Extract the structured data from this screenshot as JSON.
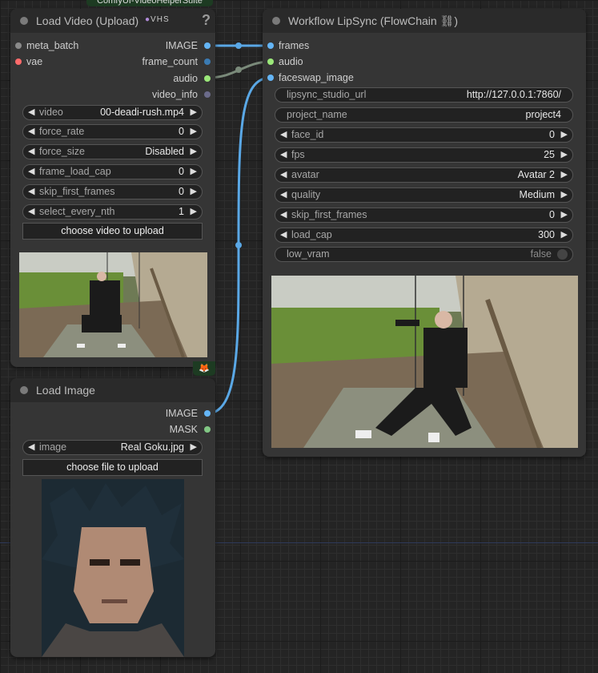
{
  "pack_tag": "ComfyUI-VideoHelperSuite",
  "colors": {
    "image_slot": "#64b5f6",
    "audio_slot": "#9be87a",
    "vae_slot": "#ff6b6b",
    "link": "#5aa8e6"
  },
  "load_video": {
    "title": "Load Video (Upload)",
    "badge": "VHS",
    "help": "?",
    "inputs": [
      "meta_batch",
      "vae"
    ],
    "outputs": [
      "IMAGE",
      "frame_count",
      "audio",
      "video_info"
    ],
    "widgets": [
      {
        "label": "video",
        "value": "00-deadi-rush.mp4"
      },
      {
        "label": "force_rate",
        "value": "0"
      },
      {
        "label": "force_size",
        "value": "Disabled"
      },
      {
        "label": "frame_load_cap",
        "value": "0"
      },
      {
        "label": "skip_first_frames",
        "value": "0"
      },
      {
        "label": "select_every_nth",
        "value": "1"
      }
    ],
    "button": "choose video to upload"
  },
  "load_image": {
    "title": "Load Image",
    "outputs": [
      "IMAGE",
      "MASK"
    ],
    "widget": {
      "label": "image",
      "value": "Real Goku.jpg"
    },
    "button": "choose file to upload"
  },
  "workflow": {
    "title": "Workflow LipSync (FlowChain ⛓)",
    "inputs": [
      "frames",
      "audio",
      "faceswap_image"
    ],
    "widgets": [
      {
        "label": "lipsync_studio_url",
        "value": "http://127.0.0.1:7860/"
      },
      {
        "label": "project_name",
        "value": "project4"
      },
      {
        "label": "face_id",
        "value": "0"
      },
      {
        "label": "fps",
        "value": "25"
      },
      {
        "label": "avatar",
        "value": "Avatar 2"
      },
      {
        "label": "quality",
        "value": "Medium"
      },
      {
        "label": "skip_first_frames",
        "value": "0"
      },
      {
        "label": "load_cap",
        "value": "300"
      },
      {
        "label": "low_vram",
        "value": "false"
      }
    ]
  }
}
